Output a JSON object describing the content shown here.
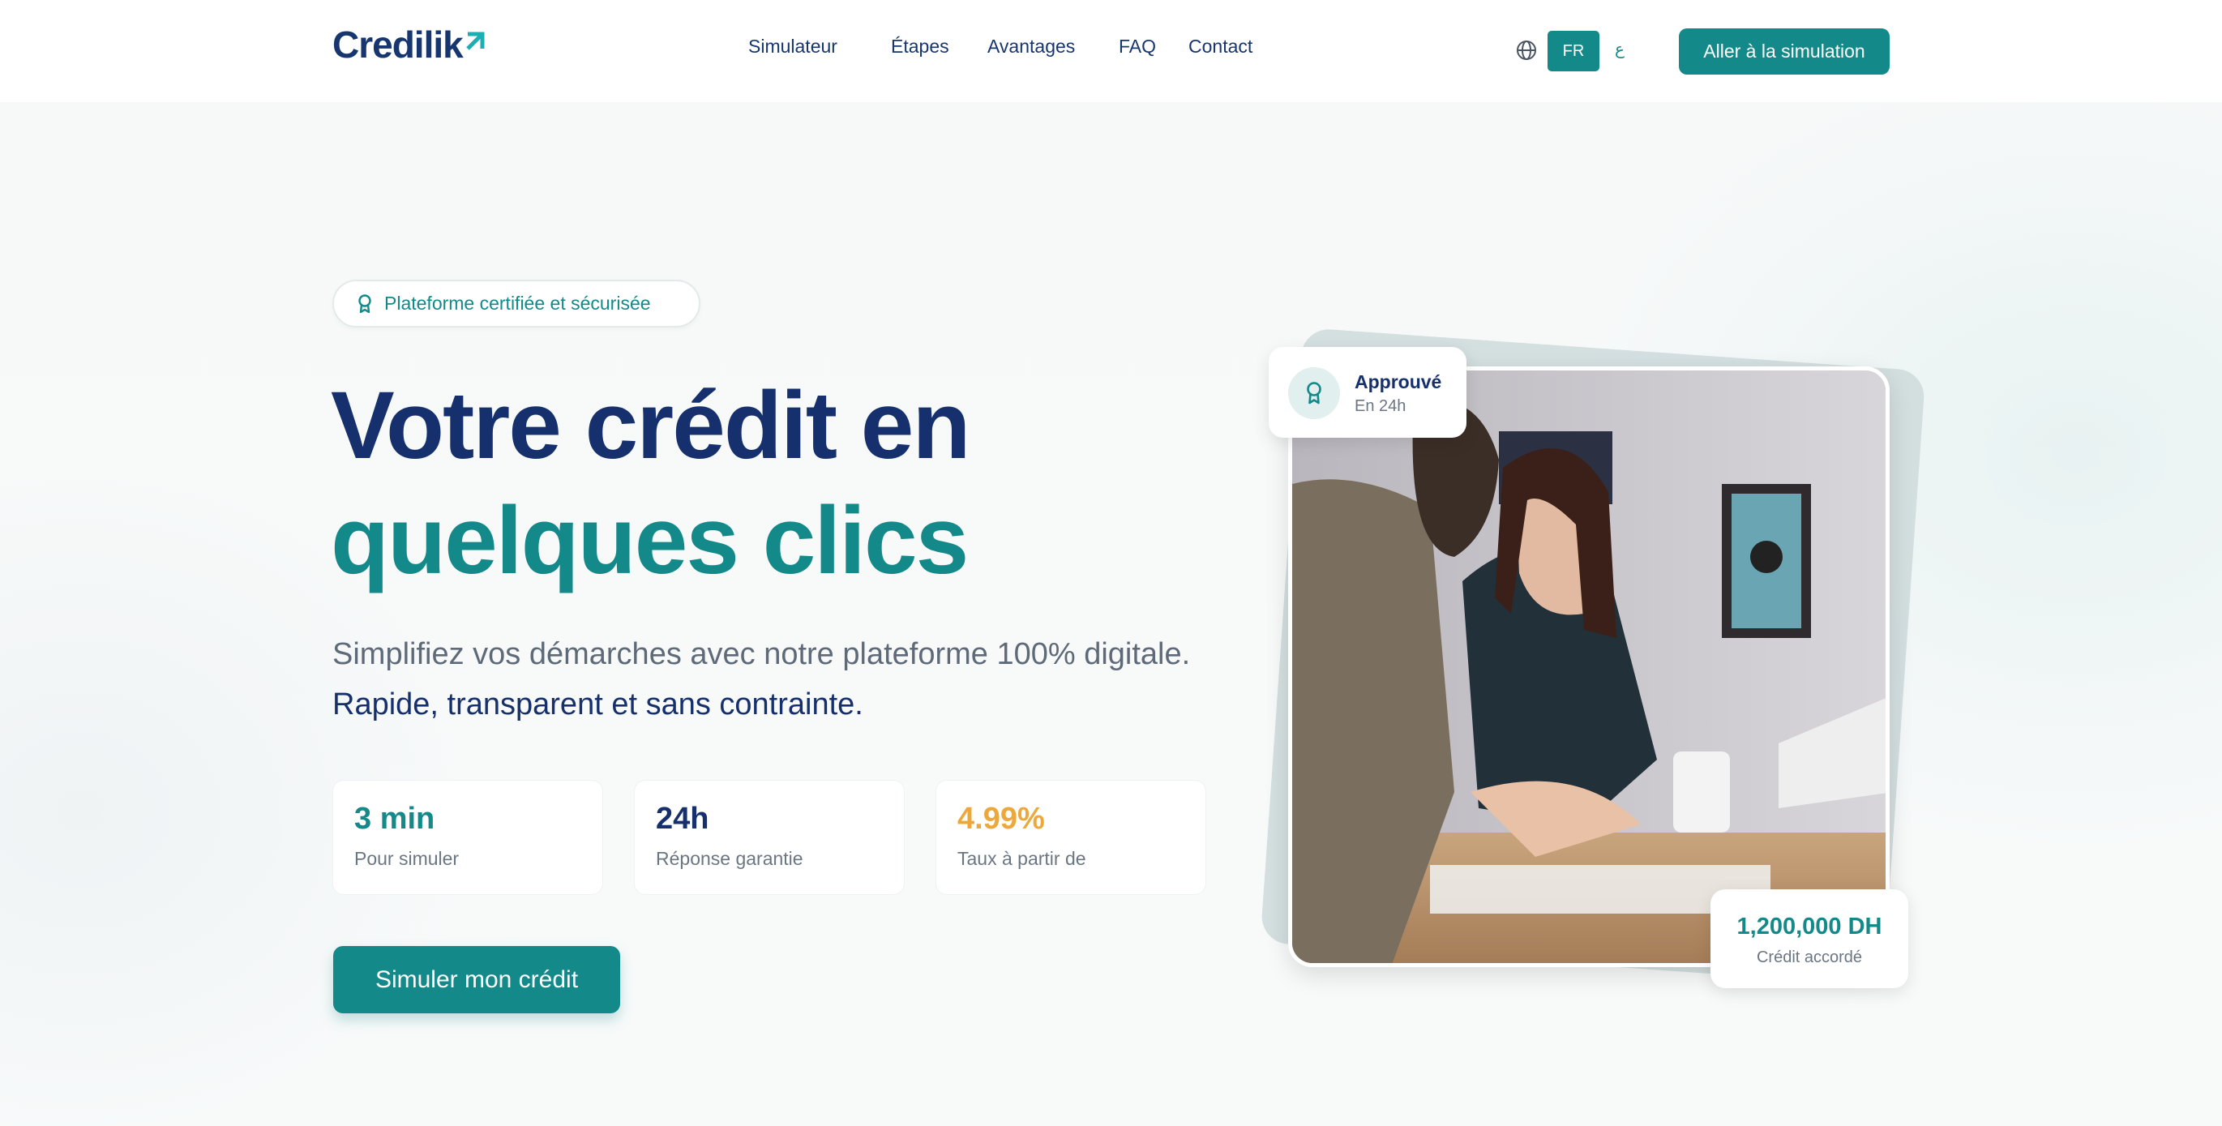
{
  "header": {
    "logo": "Credilik",
    "nav": [
      "Simulateur",
      "Étapes",
      "Avantages",
      "FAQ",
      "Contact"
    ],
    "lang_active": "FR",
    "lang_other": "ع",
    "cta": "Aller à la simulation"
  },
  "hero": {
    "badge": "Plateforme certifiée et sécurisée",
    "title_line1": "Votre crédit en",
    "title_line2": "quelques clics",
    "subtitle_plain": "Simplifiez vos démarches avec notre plateforme 100% digitale.",
    "subtitle_strong": "Rapide, transparent et sans contrainte.",
    "stats": [
      {
        "value": "3 min",
        "label": "Pour simuler",
        "color": "#13898a"
      },
      {
        "value": "24h",
        "label": "Réponse garantie",
        "color": "#15306c"
      },
      {
        "value": "4.99%",
        "label": "Taux à partir de",
        "color": "#eda83c"
      }
    ],
    "button": "Simuler mon crédit"
  },
  "cards": {
    "approved_title": "Approuvé",
    "approved_sub": "En 24h",
    "amount_value": "1,200,000 DH",
    "amount_label": "Crédit accordé"
  },
  "colors": {
    "teal": "#13898a",
    "navy": "#15306c",
    "orange": "#eda83c"
  },
  "icons": [
    "globe-icon",
    "award-icon",
    "logo-arrow-icon"
  ]
}
